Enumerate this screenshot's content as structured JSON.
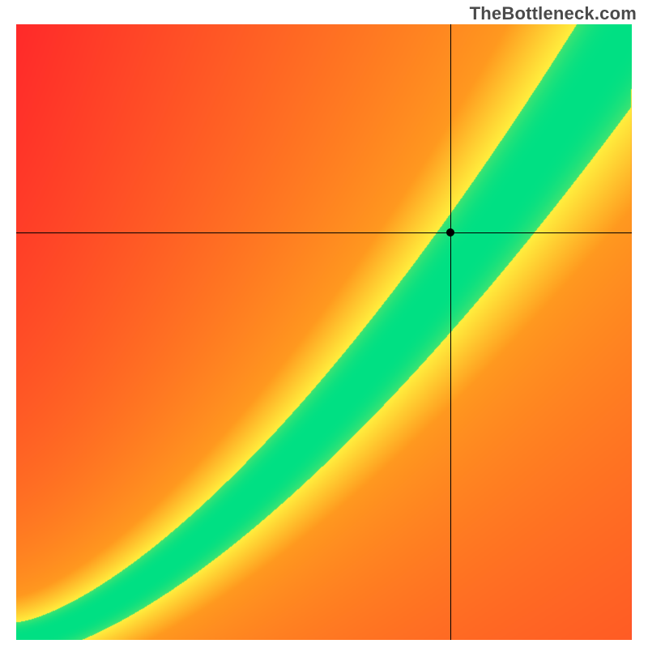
{
  "watermark": "TheBottleneck.com",
  "chart_data": {
    "type": "heatmap",
    "title": "",
    "xlabel": "",
    "ylabel": "",
    "xlim": [
      0,
      1
    ],
    "ylim": [
      0,
      1
    ],
    "grid": false,
    "legend": false,
    "palette_description": "diverging red→orange→yellow→green→yellow→red along a diagonal optimum band",
    "optimum_curve": {
      "description": "green zero-bottleneck ridge; fit approximates y ≈ x^1.5 across normalized [0,1]",
      "points": [
        {
          "x": 0.0,
          "y": 0.0
        },
        {
          "x": 0.05,
          "y": 0.011
        },
        {
          "x": 0.1,
          "y": 0.032
        },
        {
          "x": 0.15,
          "y": 0.058
        },
        {
          "x": 0.2,
          "y": 0.089
        },
        {
          "x": 0.25,
          "y": 0.125
        },
        {
          "x": 0.3,
          "y": 0.164
        },
        {
          "x": 0.35,
          "y": 0.207
        },
        {
          "x": 0.4,
          "y": 0.253
        },
        {
          "x": 0.45,
          "y": 0.302
        },
        {
          "x": 0.5,
          "y": 0.354
        },
        {
          "x": 0.55,
          "y": 0.408
        },
        {
          "x": 0.6,
          "y": 0.465
        },
        {
          "x": 0.65,
          "y": 0.524
        },
        {
          "x": 0.7,
          "y": 0.586
        },
        {
          "x": 0.75,
          "y": 0.65
        },
        {
          "x": 0.8,
          "y": 0.716
        },
        {
          "x": 0.85,
          "y": 0.783
        },
        {
          "x": 0.9,
          "y": 0.854
        },
        {
          "x": 0.95,
          "y": 0.926
        },
        {
          "x": 1.0,
          "y": 1.0
        }
      ]
    },
    "green_band_halfwidth_normalized": 0.055,
    "yellow_band_halfwidth_normalized": 0.13,
    "marker": {
      "x": 0.705,
      "y": 0.662
    },
    "colors": {
      "green": "#00e084",
      "yellow": "#ffef3e",
      "orange": "#ff9a1f",
      "red": "#ff2a2a"
    }
  }
}
